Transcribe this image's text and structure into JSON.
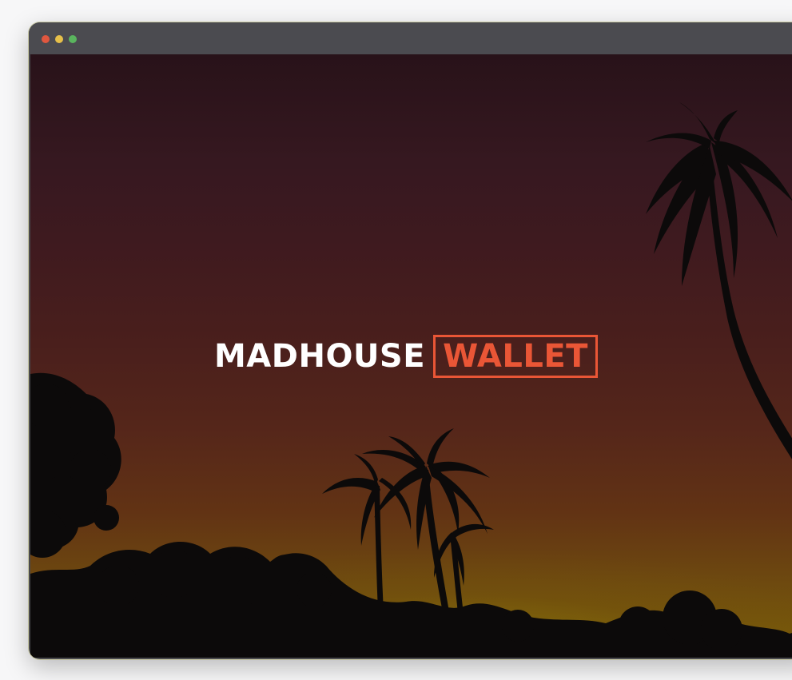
{
  "window": {
    "controls": {
      "close_color": "#e0573f",
      "minimize_color": "#e6c04a",
      "maximize_color": "#5ab55e"
    }
  },
  "hero": {
    "background_icon": "palm-tree-sunset-silhouette",
    "logo": {
      "word_primary": "MADHOUSE",
      "word_boxed": "WALLET",
      "primary_color": "#ffffff",
      "accent_color": "#ea5636"
    }
  }
}
